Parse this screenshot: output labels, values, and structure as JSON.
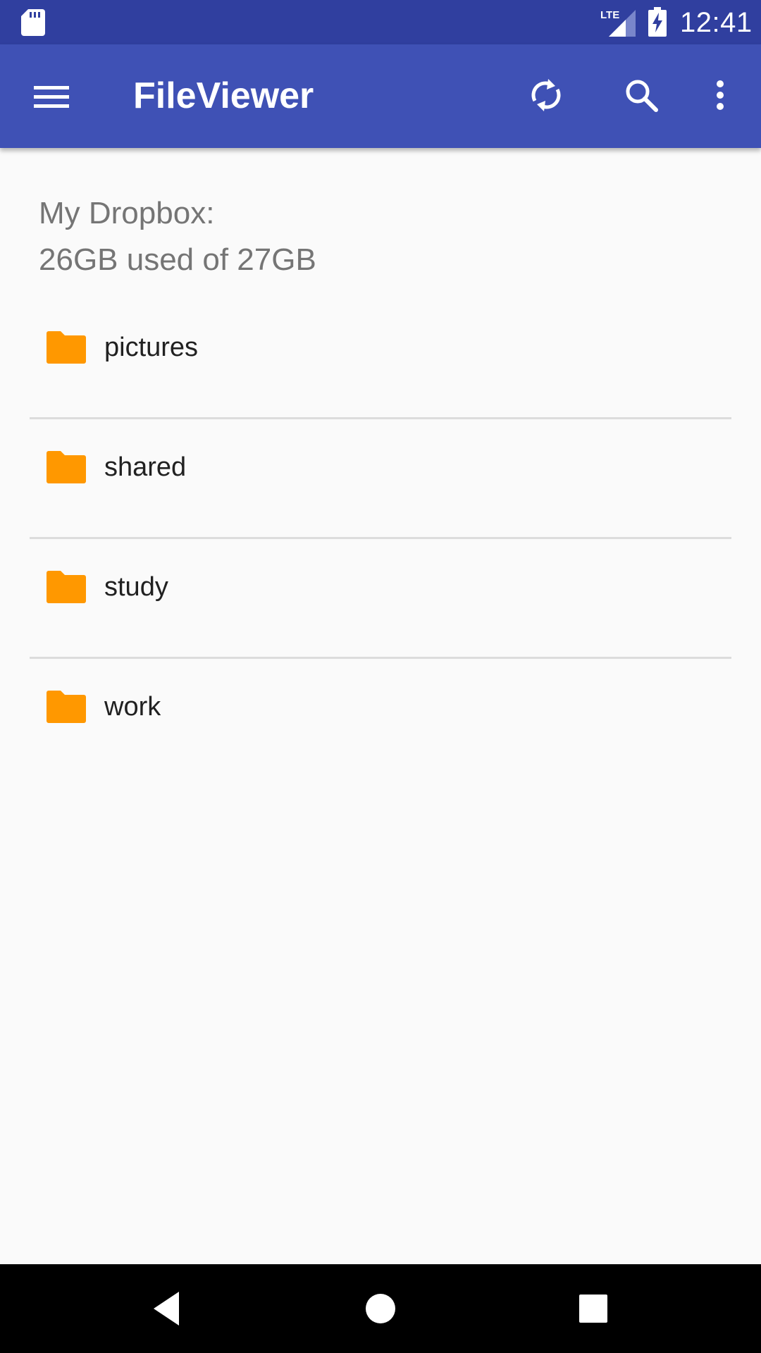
{
  "status_bar": {
    "time": "12:41",
    "network_label": "LTE",
    "icons": [
      "sd-card-icon",
      "lte-signal-icon",
      "battery-charging-icon"
    ]
  },
  "app_bar": {
    "title": "FileViewer",
    "icons": [
      "menu-icon",
      "sync-icon",
      "search-icon",
      "more-vert-icon"
    ]
  },
  "storage": {
    "line1": "My Dropbox:",
    "line2": "26GB used of 27GB"
  },
  "folders": [
    {
      "name": "pictures",
      "icon": "folder-icon"
    },
    {
      "name": "shared",
      "icon": "folder-icon"
    },
    {
      "name": "study",
      "icon": "folder-icon"
    },
    {
      "name": "work",
      "icon": "folder-icon"
    }
  ],
  "nav_bar": {
    "icons": [
      "back-icon",
      "home-icon",
      "recents-icon"
    ]
  },
  "colors": {
    "status_bar": "#303f9f",
    "app_bar": "#3f51b5",
    "folder": "#ff9800",
    "background": "#fafafa",
    "secondary_text": "#757575"
  }
}
